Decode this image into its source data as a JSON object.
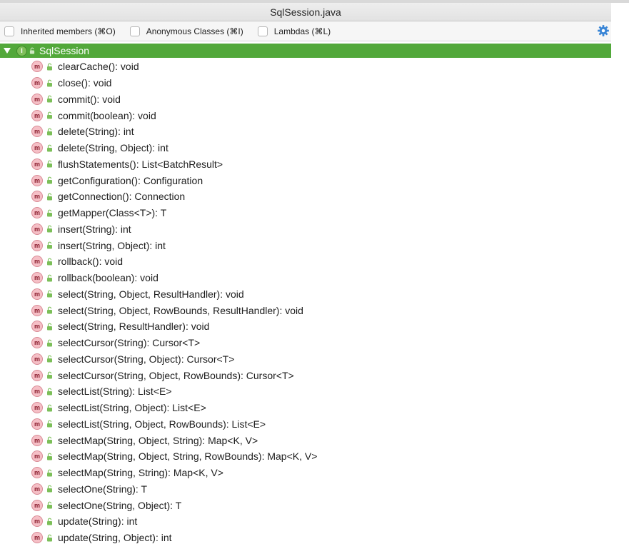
{
  "window": {
    "title": "SqlSession.java"
  },
  "filters": [
    {
      "label": "Inherited members (⌘O)",
      "checked": false
    },
    {
      "label": "Anonymous Classes (⌘I)",
      "checked": false
    },
    {
      "label": "Lambdas (⌘L)",
      "checked": false
    }
  ],
  "settings": {
    "icon": "gear-icon",
    "color": "#3a86d6"
  },
  "tree": {
    "root": {
      "label": "SqlSession",
      "expanded": true,
      "icon": "interface-icon",
      "badge": "I",
      "highlight": "#52a83a"
    },
    "method_badge": "m",
    "methods": [
      "clearCache(): void",
      "close(): void",
      "commit(): void",
      "commit(boolean): void",
      "delete(String): int",
      "delete(String, Object): int",
      "flushStatements(): List<BatchResult>",
      "getConfiguration(): Configuration",
      "getConnection(): Connection",
      "getMapper(Class<T>): T",
      "insert(String): int",
      "insert(String, Object): int",
      "rollback(): void",
      "rollback(boolean): void",
      "select(String, Object, ResultHandler): void",
      "select(String, Object, RowBounds, ResultHandler): void",
      "select(String, ResultHandler): void",
      "selectCursor(String): Cursor<T>",
      "selectCursor(String, Object): Cursor<T>",
      "selectCursor(String, Object, RowBounds): Cursor<T>",
      "selectList(String): List<E>",
      "selectList(String, Object): List<E>",
      "selectList(String, Object, RowBounds): List<E>",
      "selectMap(String, Object, String): Map<K, V>",
      "selectMap(String, Object, String, RowBounds): Map<K, V>",
      "selectMap(String, String): Map<K, V>",
      "selectOne(String): T",
      "selectOne(String, Object): T",
      "update(String): int",
      "update(String, Object): int"
    ]
  }
}
